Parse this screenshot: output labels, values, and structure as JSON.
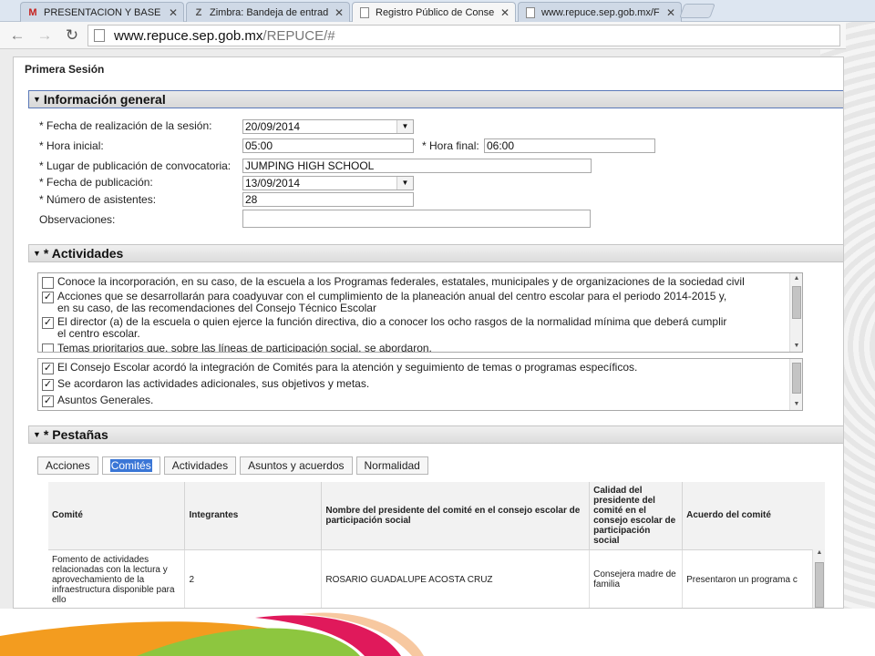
{
  "browser": {
    "tabs": [
      {
        "icon": "gmail-icon",
        "fav": "M",
        "label": "PRESENTACION Y BASE D",
        "active": false
      },
      {
        "icon": "zimbra-icon",
        "fav": "Z",
        "label": "Zimbra: Bandeja de entrad",
        "active": false
      },
      {
        "icon": "page-icon",
        "fav": "",
        "label": "Registro Público de Conse",
        "active": true
      },
      {
        "icon": "page-icon",
        "fav": "",
        "label": "www.repuce.sep.gob.mx/F",
        "active": false
      }
    ],
    "url_host": "www.repuce.sep.gob.mx",
    "url_path": "/REPUCE/#"
  },
  "page": {
    "session_title": "Primera Sesión",
    "general": {
      "header": "Información general",
      "fecha_sesion_label": "* Fecha de realización de la sesión:",
      "fecha_sesion_value": "20/09/2014",
      "hora_inicial_label": "* Hora inicial:",
      "hora_inicial_value": "05:00",
      "hora_final_label": "* Hora final:",
      "hora_final_value": "06:00",
      "lugar_label": "* Lugar de publicación de convocatoria:",
      "lugar_value": "JUMPING HIGH SCHOOL",
      "fecha_pub_label": "* Fecha de publicación:",
      "fecha_pub_value": "13/09/2014",
      "asistentes_label": "* Número de asistentes:",
      "asistentes_value": "28",
      "observaciones_label": "Observaciones:",
      "observaciones_value": ""
    },
    "actividades": {
      "header": "* Actividades",
      "list1": [
        {
          "checked": false,
          "line1": "Conoce la incorporación, en su caso, de la escuela a los Programas federales, estatales, municipales y de organizaciones de la sociedad civil",
          "line2": ""
        },
        {
          "checked": true,
          "line1": "Acciones que se desarrollarán para coadyuvar con el cumplimiento de la planeación anual del centro escolar para el periodo 2014-2015 y,",
          "line2": "en su caso, de las recomendaciones del Consejo Técnico Escolar"
        },
        {
          "checked": true,
          "line1": "El director (a) de la escuela o quien ejerce la función directiva, dio a conocer los ocho rasgos de la normalidad mínima que deberá cumplir",
          "line2": "el centro escolar."
        },
        {
          "checked": false,
          "line1": "Temas prioritarios que, sobre las líneas de participación social, se abordaron.",
          "line2": ""
        }
      ],
      "list2": [
        {
          "checked": true,
          "line1": "El Consejo Escolar acordó la integración de Comités para la atención y seguimiento de temas o programas específicos."
        },
        {
          "checked": true,
          "line1": "Se acordaron las actividades adicionales, sus objetivos y metas."
        },
        {
          "checked": true,
          "line1": "Asuntos Generales."
        }
      ]
    },
    "pestanas": {
      "header": "* Pestañas",
      "tabs": [
        "Acciones",
        "Comités",
        "Actividades",
        "Asuntos y acuerdos",
        "Normalidad"
      ],
      "active_tab": "Comités",
      "columns": [
        "Comité",
        "Integrantes",
        "Nombre del presidente del comité en el consejo escolar de participación social",
        "Calidad del presidente del comité en el consejo escolar de participación social",
        "Acuerdo del comité"
      ],
      "rows": [
        [
          "Fomento de actividades relacionadas con la lectura y aprovechamiento de la infraestructura disponible para ello",
          "2",
          "ROSARIO GUADALUPE ACOSTA CRUZ",
          "Consejera madre de familia",
          "Presentaron un programa c"
        ]
      ]
    }
  },
  "colors": {
    "accent_blue": "#3a76d6",
    "deco_orange": "#f39c1f",
    "deco_green": "#8dc63f",
    "deco_magenta": "#e0195b"
  }
}
